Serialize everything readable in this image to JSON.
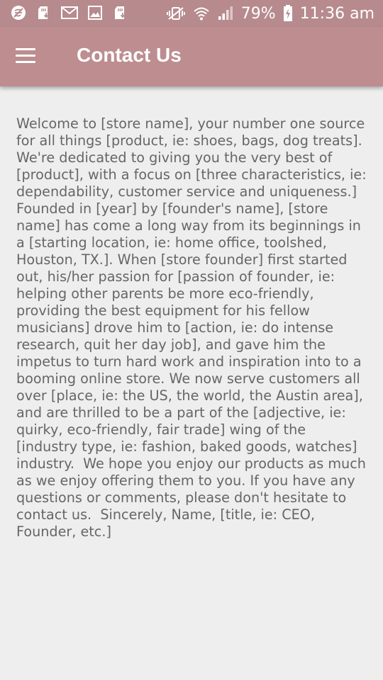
{
  "status_bar": {
    "battery_percent": "79%",
    "time": "11:36 am",
    "icons_left": [
      "wind-off-icon",
      "sd-card-download-icon",
      "mail-icon",
      "image-icon",
      "sd-card-download-icon"
    ],
    "icons_right": [
      "vibrate-mute-icon",
      "wifi-icon",
      "signal-icon",
      "battery-charging-icon"
    ]
  },
  "app_bar": {
    "title": "Contact Us",
    "menu_icon": "hamburger-menu-icon",
    "background_color": "#bd8d90"
  },
  "content": {
    "body_text": "Welcome to [store name], your number one source for all things [product, ie: shoes, bags, dog treats]. We're dedicated to giving you the very best of [product], with a focus on [three characteristics, ie: dependability, customer service and uniqueness.] Founded in [year] by [founder's name], [store name] has come a long way from its beginnings in a [starting location, ie: home office, toolshed, Houston, TX.]. When [store founder] first started out, his/her passion for [passion of founder, ie: helping other parents be more eco-friendly, providing the best equipment for his fellow musicians] drove him to [action, ie: do intense research, quit her day job], and gave him the impetus to turn hard work and inspiration into to a booming online store. We now serve customers all over [place, ie: the US, the world, the Austin area], and are thrilled to be a part of the [adjective, ie: quirky, eco-friendly, fair trade] wing of the [industry type, ie: fashion, baked goods, watches] industry.  We hope you enjoy our products as much as we enjoy offering them to you. If you have any questions or comments, please don't hesitate to contact us.  Sincerely, Name, [title, ie: CEO, Founder, etc.]"
  }
}
